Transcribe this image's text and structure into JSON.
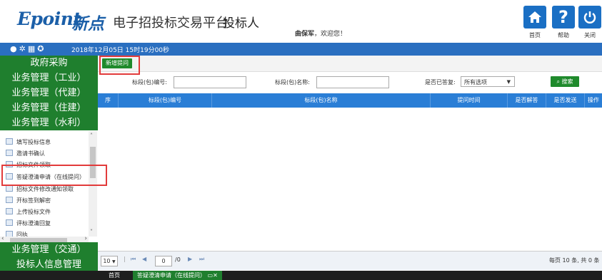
{
  "header": {
    "logo_text": "Epoint",
    "brand": "新点",
    "platform_title": "电子招投标交易平台",
    "role": "投标人",
    "welcome_name": "曲保军",
    "welcome_suffix": "，欢迎您！",
    "buttons": [
      {
        "label": "首页",
        "icon": "home-icon"
      },
      {
        "label": "帮助",
        "icon": "help-icon"
      },
      {
        "label": "关闭",
        "icon": "power-icon"
      }
    ]
  },
  "statusbar": {
    "datetime": "2018年12月05日 15时19分00秒"
  },
  "sidebar": {
    "groups_top": [
      "政府采购",
      "业务管理（工业）",
      "业务管理（代建）",
      "业务管理（住建）",
      "业务管理（水利）"
    ],
    "tree_items": [
      "填写投标信息",
      "邀请书确认",
      "招标文件领取",
      "答疑澄清申请（在线提问）",
      "招标文件修改通知领取",
      "开标签到解密",
      "上传投标文件",
      "评标澄清回复",
      "回执"
    ],
    "groups_bottom": [
      "业务管理（交通）",
      "投标人信息管理"
    ]
  },
  "toolbar": {
    "new_question_label": "新增提问"
  },
  "search": {
    "section_no_label": "标段(包)编号:",
    "section_no_value": "",
    "section_name_label": "标段(包)名称:",
    "section_name_value": "",
    "answered_label": "是否已答复:",
    "answered_value": "所有选项",
    "search_button": "搜索"
  },
  "table": {
    "columns": [
      "序",
      "标段(包)编号",
      "标段(包)名称",
      "提问时间",
      "是否解答",
      "是否发送",
      "操作"
    ]
  },
  "pager": {
    "page_size": "10",
    "current_page": "0",
    "total_pages": "/0",
    "summary": "每页 10 条, 共 0 条"
  },
  "tabs": {
    "home": "首页",
    "active_tab": "答疑澄清申请（在线提问）"
  },
  "colors": {
    "brand_blue": "#1b5fa8",
    "nav_green": "#1f7f2e",
    "header_blue": "#2a7ed6",
    "highlight_red": "#e23b3b"
  }
}
